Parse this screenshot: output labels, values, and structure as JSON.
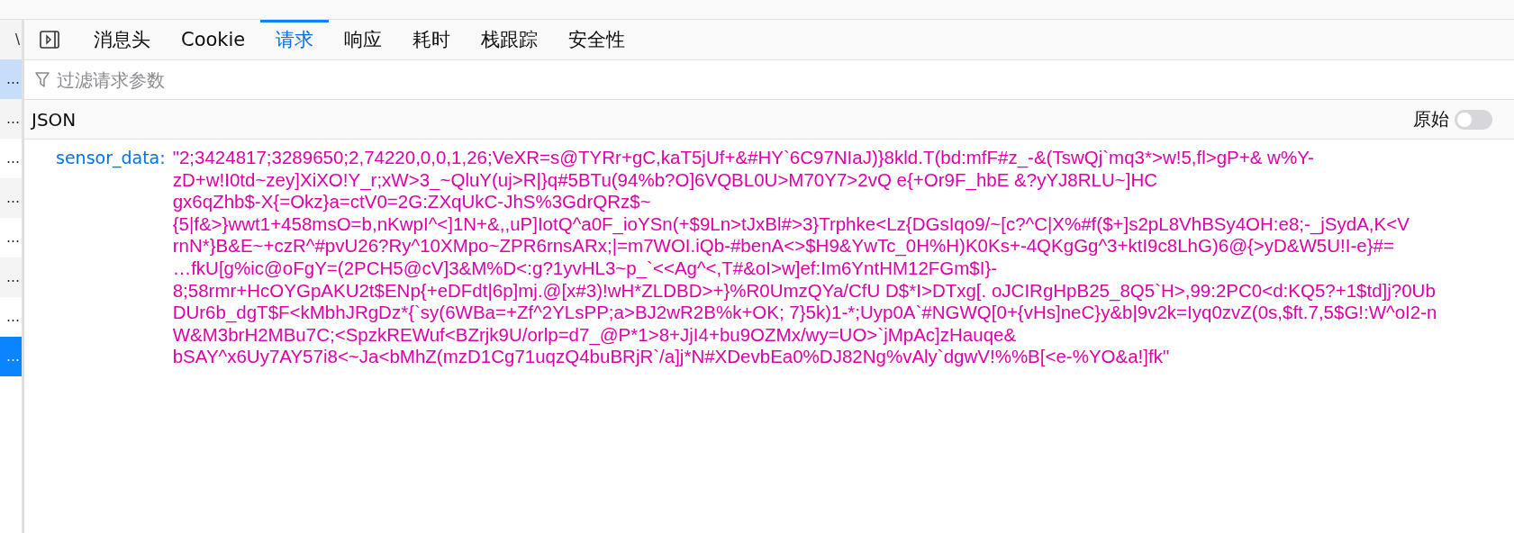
{
  "sidebar": {
    "items": [
      {
        "label": "\\",
        "selected": false,
        "highlighted": false
      },
      {
        "label": "…",
        "selected": false,
        "highlighted": true
      },
      {
        "label": "…",
        "selected": false,
        "highlighted": false
      },
      {
        "label": "…",
        "selected": false,
        "highlighted": false
      },
      {
        "label": "…",
        "selected": false,
        "highlighted": false
      },
      {
        "label": "…",
        "selected": false,
        "highlighted": false
      },
      {
        "label": "…",
        "selected": false,
        "highlighted": false
      },
      {
        "label": "…",
        "selected": false,
        "highlighted": false
      },
      {
        "label": "…",
        "selected": true,
        "highlighted": false
      }
    ]
  },
  "tabs": [
    {
      "label": "消息头",
      "selected": false
    },
    {
      "label": "Cookie",
      "selected": false
    },
    {
      "label": "请求",
      "selected": true
    },
    {
      "label": "响应",
      "selected": false
    },
    {
      "label": "耗时",
      "selected": false
    },
    {
      "label": "栈跟踪",
      "selected": false
    },
    {
      "label": "安全性",
      "selected": false
    }
  ],
  "filter": {
    "placeholder": "过滤请求参数"
  },
  "section": {
    "title": "JSON",
    "raw_label": "原始",
    "raw_on": false
  },
  "params": [
    {
      "key": "sensor_data:",
      "value_lines": [
        "\"2;3424817;3289650;2,74220,0,0,1,26;VeXR=s@TYRr+gC,kaT5jUf+&#HY`6C97NIaJ)}8kld.T(bd:mfF#z_-&(TswQj`mq3*>w!5,fl>gP+& w%Y-",
        "zD+w!I0td~zey]XiXO!Y_r;xW>3_~QluY(uj>R|}q#5BTu(94%b?O]6VQBL0U>M70Y7>2vQ e{+Or9F_hbE &?yYJ8RLU~]HC",
        "gx6qZhb$-X{=Okz}a=ctV0=2G:ZXqUkC-JhS%3GdrQRz$~",
        "{5|f&>}wwt1+458msO=b,nKwpI^<]1N+&,,uP]IotQ^a0F_ioYSn(+$9Ln>tJxBl#>3}Trphke<Lz{DGsIqo9/~[c?^C|X%#f($+]s2pL8VhBSy4OH:e8;-_jSydA,K<V",
        "rnN*}B&E~+czR^#pvU26?Ry^10XMpo~ZPR6rnsARx;|=m7WOI.iQb-#benA<>$H9&YwTc_0H%H)K0Ks+-4QKgGg^3+ktI9c8LhG)6@{>yD&W5U!I-e}#=",
        "…fkU[g%ic@oFgY=(2PCH5@cV]3&M%D<:g?1yvHL3~p_`<<Ag^<,T#&oI>w]ef:Im6YntHM12FGm$I}-",
        "8;58rmr+HcOYGpAKU2t$ENp{+eDFdt|6p]mj.@[x#3)!wH*ZLDBD>+}%R0UmzQYa/CfU D$*I>DTxg[. oJCIRgHpB25_8Q5`H>,99:2PC0<d:KQ5?+1$td]j?0Ub",
        "DUr6b_dgT$F<kMbhJRgDz*{`sy(6WBa=+Zf^2YLsPP;a>BJ2wR2B%k+OK; 7}5k)1-*;Uyp0A`#NGWQ[0+{vHs]neC}y&b|9v2k=Iyq0zvZ(0s,$ft.7,5$G!:W^oI2-n",
        "W&M3brH2MBu7C;<SpzkREWuf<BZrjk9U/orlp=d7_@P*1>8+JjI4+bu9OZMx/wy=UO>`jMpAc]zHauqe&",
        "bSAY^x6Uy7AY57i8<~Ja<bMhZ(mzD1Cg71uqzQ4buBRjR`/a]j*N#XDevbEa0%DJ82Ng%vAly`dgwV!%%B[<e-%YO&a!]fk\""
      ]
    }
  ]
}
